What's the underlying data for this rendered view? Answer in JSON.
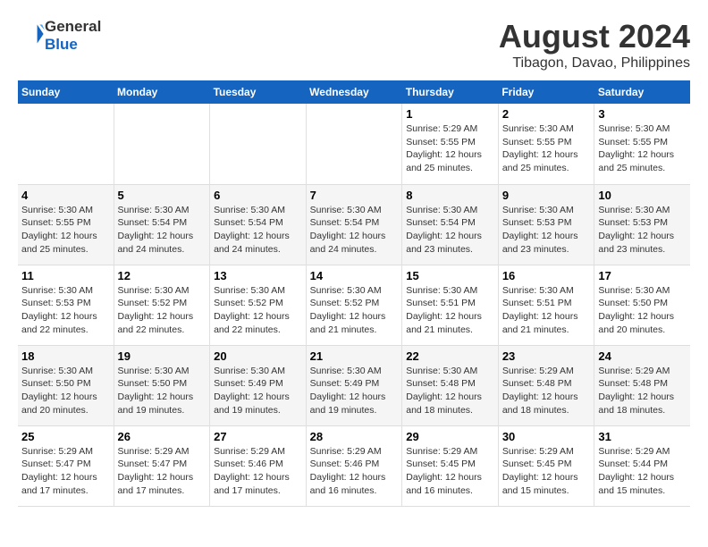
{
  "header": {
    "logo_line1": "General",
    "logo_line2": "Blue",
    "month_year": "August 2024",
    "location": "Tibagon, Davao, Philippines"
  },
  "weekdays": [
    "Sunday",
    "Monday",
    "Tuesday",
    "Wednesday",
    "Thursday",
    "Friday",
    "Saturday"
  ],
  "weeks": [
    [
      {
        "day": "",
        "info": ""
      },
      {
        "day": "",
        "info": ""
      },
      {
        "day": "",
        "info": ""
      },
      {
        "day": "",
        "info": ""
      },
      {
        "day": "1",
        "info": "Sunrise: 5:29 AM\nSunset: 5:55 PM\nDaylight: 12 hours\nand 25 minutes."
      },
      {
        "day": "2",
        "info": "Sunrise: 5:30 AM\nSunset: 5:55 PM\nDaylight: 12 hours\nand 25 minutes."
      },
      {
        "day": "3",
        "info": "Sunrise: 5:30 AM\nSunset: 5:55 PM\nDaylight: 12 hours\nand 25 minutes."
      }
    ],
    [
      {
        "day": "4",
        "info": "Sunrise: 5:30 AM\nSunset: 5:55 PM\nDaylight: 12 hours\nand 25 minutes."
      },
      {
        "day": "5",
        "info": "Sunrise: 5:30 AM\nSunset: 5:54 PM\nDaylight: 12 hours\nand 24 minutes."
      },
      {
        "day": "6",
        "info": "Sunrise: 5:30 AM\nSunset: 5:54 PM\nDaylight: 12 hours\nand 24 minutes."
      },
      {
        "day": "7",
        "info": "Sunrise: 5:30 AM\nSunset: 5:54 PM\nDaylight: 12 hours\nand 24 minutes."
      },
      {
        "day": "8",
        "info": "Sunrise: 5:30 AM\nSunset: 5:54 PM\nDaylight: 12 hours\nand 23 minutes."
      },
      {
        "day": "9",
        "info": "Sunrise: 5:30 AM\nSunset: 5:53 PM\nDaylight: 12 hours\nand 23 minutes."
      },
      {
        "day": "10",
        "info": "Sunrise: 5:30 AM\nSunset: 5:53 PM\nDaylight: 12 hours\nand 23 minutes."
      }
    ],
    [
      {
        "day": "11",
        "info": "Sunrise: 5:30 AM\nSunset: 5:53 PM\nDaylight: 12 hours\nand 22 minutes."
      },
      {
        "day": "12",
        "info": "Sunrise: 5:30 AM\nSunset: 5:52 PM\nDaylight: 12 hours\nand 22 minutes."
      },
      {
        "day": "13",
        "info": "Sunrise: 5:30 AM\nSunset: 5:52 PM\nDaylight: 12 hours\nand 22 minutes."
      },
      {
        "day": "14",
        "info": "Sunrise: 5:30 AM\nSunset: 5:52 PM\nDaylight: 12 hours\nand 21 minutes."
      },
      {
        "day": "15",
        "info": "Sunrise: 5:30 AM\nSunset: 5:51 PM\nDaylight: 12 hours\nand 21 minutes."
      },
      {
        "day": "16",
        "info": "Sunrise: 5:30 AM\nSunset: 5:51 PM\nDaylight: 12 hours\nand 21 minutes."
      },
      {
        "day": "17",
        "info": "Sunrise: 5:30 AM\nSunset: 5:50 PM\nDaylight: 12 hours\nand 20 minutes."
      }
    ],
    [
      {
        "day": "18",
        "info": "Sunrise: 5:30 AM\nSunset: 5:50 PM\nDaylight: 12 hours\nand 20 minutes."
      },
      {
        "day": "19",
        "info": "Sunrise: 5:30 AM\nSunset: 5:50 PM\nDaylight: 12 hours\nand 19 minutes."
      },
      {
        "day": "20",
        "info": "Sunrise: 5:30 AM\nSunset: 5:49 PM\nDaylight: 12 hours\nand 19 minutes."
      },
      {
        "day": "21",
        "info": "Sunrise: 5:30 AM\nSunset: 5:49 PM\nDaylight: 12 hours\nand 19 minutes."
      },
      {
        "day": "22",
        "info": "Sunrise: 5:30 AM\nSunset: 5:48 PM\nDaylight: 12 hours\nand 18 minutes."
      },
      {
        "day": "23",
        "info": "Sunrise: 5:29 AM\nSunset: 5:48 PM\nDaylight: 12 hours\nand 18 minutes."
      },
      {
        "day": "24",
        "info": "Sunrise: 5:29 AM\nSunset: 5:48 PM\nDaylight: 12 hours\nand 18 minutes."
      }
    ],
    [
      {
        "day": "25",
        "info": "Sunrise: 5:29 AM\nSunset: 5:47 PM\nDaylight: 12 hours\nand 17 minutes."
      },
      {
        "day": "26",
        "info": "Sunrise: 5:29 AM\nSunset: 5:47 PM\nDaylight: 12 hours\nand 17 minutes."
      },
      {
        "day": "27",
        "info": "Sunrise: 5:29 AM\nSunset: 5:46 PM\nDaylight: 12 hours\nand 17 minutes."
      },
      {
        "day": "28",
        "info": "Sunrise: 5:29 AM\nSunset: 5:46 PM\nDaylight: 12 hours\nand 16 minutes."
      },
      {
        "day": "29",
        "info": "Sunrise: 5:29 AM\nSunset: 5:45 PM\nDaylight: 12 hours\nand 16 minutes."
      },
      {
        "day": "30",
        "info": "Sunrise: 5:29 AM\nSunset: 5:45 PM\nDaylight: 12 hours\nand 15 minutes."
      },
      {
        "day": "31",
        "info": "Sunrise: 5:29 AM\nSunset: 5:44 PM\nDaylight: 12 hours\nand 15 minutes."
      }
    ]
  ]
}
